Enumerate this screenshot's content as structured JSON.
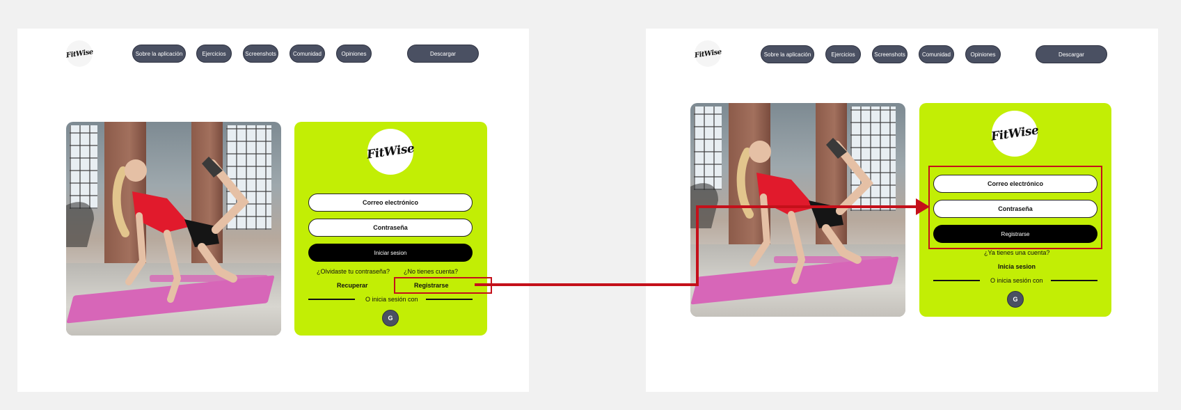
{
  "colors": {
    "accent": "#c2ee05",
    "nav_pill": "#4a5062",
    "annotation": "#c4101a"
  },
  "brand": {
    "logo_text": "FitWise"
  },
  "nav": {
    "items": [
      "Sobre la aplicación",
      "Ejercicios",
      "Screenshots",
      "Comunidad",
      "Opiniones"
    ],
    "download_label": "Descargar"
  },
  "login": {
    "email_placeholder": "Correo electrónico",
    "password_placeholder": "Contraseña",
    "submit_label": "Iniciar sesion",
    "forgot_question": "¿Olvidaste tu contraseña?",
    "no_account_question": "¿No tienes cuenta?",
    "recover_link": "Recuperar",
    "register_link": "Registrarse",
    "alt_login_text": "O inicia sesión con",
    "google_label": "G"
  },
  "register": {
    "email_placeholder": "Correo electrónico",
    "password_placeholder": "Contraseña",
    "submit_label": "Registrarse",
    "have_account_question": "¿Ya tienes una cuenta?",
    "login_link": "Inicia sesion",
    "alt_login_text": "O inicia sesión con",
    "google_label": "G"
  },
  "annotation": {
    "type": "flow-arrow",
    "from": "register_link",
    "to": "register-form-fields"
  }
}
